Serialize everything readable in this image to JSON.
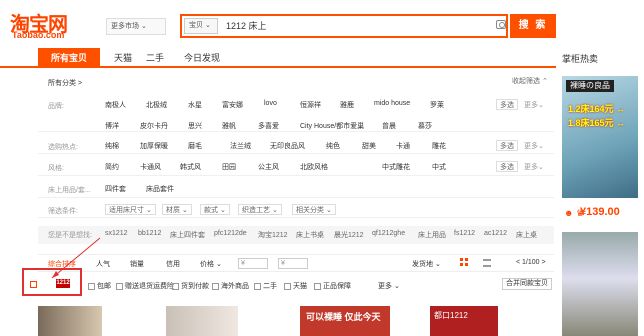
{
  "header": {
    "logo_cn": "淘宝网",
    "logo_en": "Taobao.com",
    "more_market": "更多市场 ⌄",
    "search_scope": "宝贝 ⌄",
    "search_value": "1212 床上",
    "search_button": "搜 索"
  },
  "nav": {
    "tabs": [
      "所有宝贝",
      "天猫",
      "二手",
      "今日发现"
    ],
    "right_title": "掌柜热卖"
  },
  "breadcrumb": "所有分类 >",
  "collapse_label": "收起筛选 ⌃",
  "filters": {
    "brand_label": "品牌:",
    "brand_row1": [
      "南极人",
      "北极绒",
      "水星",
      "富安娜",
      "lovo",
      "恒源祥",
      "雅鹿",
      "mido house",
      "罗莱"
    ],
    "brand_row2": [
      "博洋",
      "皮尔卡丹",
      "思兴",
      "雅帆",
      "多喜爱",
      "City House/都市爱巢",
      "曾晨",
      "慕莎"
    ],
    "hot_label": "选购热点:",
    "hot_values": [
      "纯棉",
      "加厚保暖",
      "磨毛",
      "法兰绒",
      "无印良品风",
      "纯色",
      "甜美",
      "卡通",
      "雕花"
    ],
    "style_label": "风格:",
    "style_values": [
      "简约",
      "卡通风",
      "韩式风",
      "田园",
      "公主风",
      "北欧风格",
      "中式雕花",
      "中式"
    ],
    "cat_label": "床上用品/套...",
    "cat_values": [
      "四件套",
      "床品套件"
    ],
    "filter_label": "筛选条件:",
    "filter_values": [
      "适用床尺寸 ⌄",
      "材质 ⌄",
      "款式 ⌄",
      "织造工艺 ⌄",
      "相关分类 ⌄"
    ],
    "multi": "多选",
    "more": "更多⌄"
  },
  "suggest": {
    "label": "您是不是想找:",
    "values": [
      "sx1212",
      "bb1212",
      "床上四件套",
      "pfc1212de",
      "淘宝1212",
      "床上书桌",
      "晨光1212",
      "qf1212ghe",
      "床上用品",
      "fs1212",
      "ac1212",
      "床上桌"
    ]
  },
  "sort": {
    "labels": [
      "综合排序",
      "人气",
      "销量",
      "信用",
      "价格 ⌄"
    ],
    "price_from": "¥",
    "price_to": "¥",
    "ship_from": "发货地 ⌄",
    "pager": "< 1/100 >"
  },
  "checks": [
    "包邮",
    "赠送退货运费险",
    "货到付款",
    "海外商品",
    "二手",
    "天猫",
    "正品保障"
  ],
  "checks_more": "更多 ⌄",
  "merge_button": "合并同款宝贝",
  "tmall_tag": "1212",
  "ad": {
    "badge": "裸睡の良品",
    "price1": "1.2床164元 ↔",
    "price2": "1.8床165元 ↔",
    "price_big": "¥139.00",
    "icons": "☻ ♛"
  },
  "thumbs": {
    "t3_text": "可以裸睡 仅此今天",
    "t4_text": "都口1212"
  }
}
